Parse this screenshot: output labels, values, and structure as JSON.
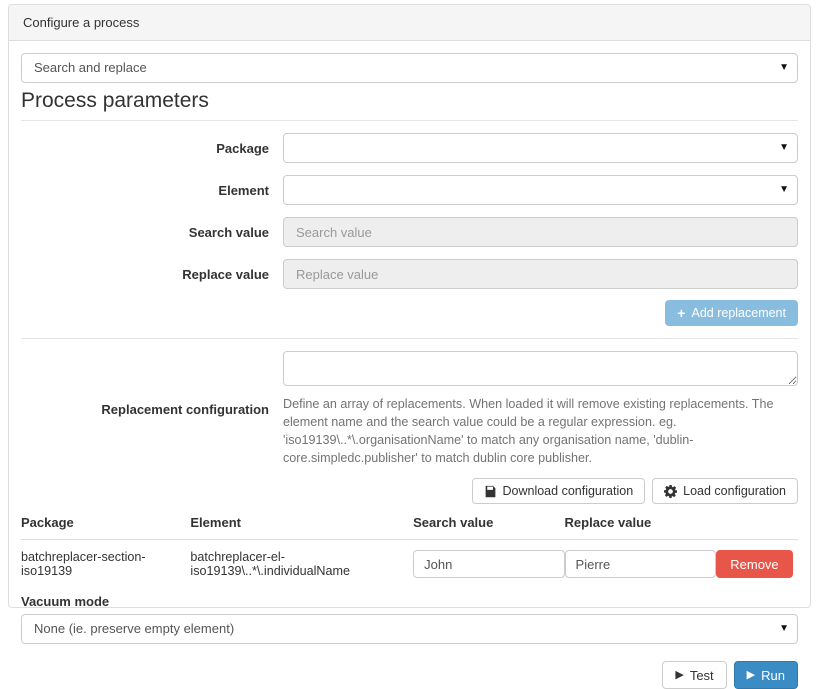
{
  "panel": {
    "title": "Configure a process"
  },
  "process_select": {
    "selected": "Search and replace",
    "caret": "▼"
  },
  "section": {
    "title": "Process parameters"
  },
  "form": {
    "package": {
      "label": "Package",
      "value": "",
      "caret": "▼"
    },
    "element": {
      "label": "Element",
      "value": "",
      "caret": "▼"
    },
    "search_value": {
      "label": "Search value",
      "placeholder": "Search value",
      "value": ""
    },
    "replace_value": {
      "label": "Replace value",
      "placeholder": "Replace value",
      "value": ""
    },
    "add_replacement": {
      "label": "Add replacement",
      "icon": "plus-icon",
      "glyph": "+"
    },
    "replacement_configuration": {
      "label": "Replacement configuration",
      "value": "",
      "help": "Define an array of replacements. When loaded it will remove existing replacements. The element name and the search value could be a regular expression. eg. 'iso19139\\..*\\.organisationName' to match any organisation name, 'dublin-core.simpledc.publisher' to match dublin core publisher."
    },
    "download_configuration": {
      "label": "Download configuration",
      "icon": "save-icon"
    },
    "load_configuration": {
      "label": "Load configuration",
      "icon": "gear-icon"
    }
  },
  "table": {
    "columns": [
      "Package",
      "Element",
      "Search value",
      "Replace value",
      ""
    ],
    "rows": [
      {
        "package": "batchreplacer-section-iso19139",
        "element": "batchreplacer-el-iso19139\\..*\\.individualName",
        "search_value": "John",
        "replace_value": "Pierre",
        "remove_label": "Remove"
      }
    ]
  },
  "vacuum": {
    "label": "Vacuum mode",
    "selected": "None (ie. preserve empty element)",
    "caret": "▼"
  },
  "footer": {
    "test": {
      "label": "Test",
      "glyph": "▶"
    },
    "run": {
      "label": "Run",
      "glyph": "▶"
    }
  },
  "colors": {
    "info": "#88bddf",
    "danger": "#e8564a",
    "primary": "#3b8cc4",
    "panel_header_bg": "#f5f5f5",
    "border": "#dddddd"
  }
}
